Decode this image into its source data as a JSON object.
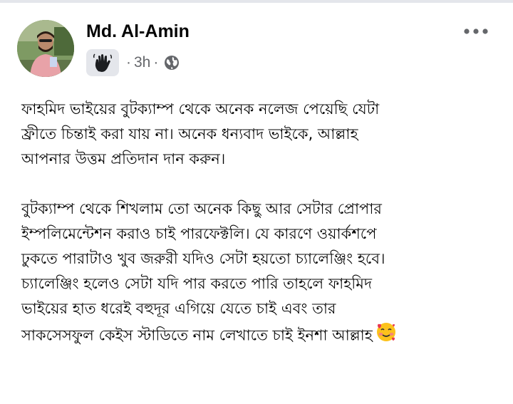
{
  "post": {
    "author": "Md. Al-Amin",
    "time": "3h",
    "separator": "·",
    "audience_icon": "globe-icon",
    "badge_icon": "waving-hand-icon",
    "menu_icon": "more-options-icon",
    "paragraphs": [
      [
        "ফাহমিদ ভাইয়ের বুটক্যাম্প থেকে অনেক নলেজ পেয়েছি যেটা",
        "ফ্রীতে চিন্তাই করা যায় না। অনেক ধন্যবাদ ভাইকে, আল্লাহ",
        "আপনার উত্তম প্রতিদান দান করুন।"
      ],
      [
        "বুটক্যাম্প থেকে শিখলাম তো অনেক কিছু আর সেটার প্রোপার",
        "ইম্পলিমেন্টেশন করাও চাই পারফেক্টলি। যে কারণে ওয়ার্কশপে",
        "ঢুকতে পারাটাও খুব জরুরী যদিও সেটা হয়তো চ্যালেঞ্জিং হবে।",
        "চ্যালেঞ্জিং হলেও সেটা যদি পার করতে পারি তাহলে ফাহমিদ",
        "ভাইয়ের হাত ধরেই বহুদূর এগিয়ে যেতে চাই এবং তার",
        "সাকসেসফুল কেইস স্টাডিতে নাম লেখাতে চাই ইনশা আল্লাহ"
      ]
    ],
    "end_emoji": "smiling-face-with-hearts-icon"
  }
}
